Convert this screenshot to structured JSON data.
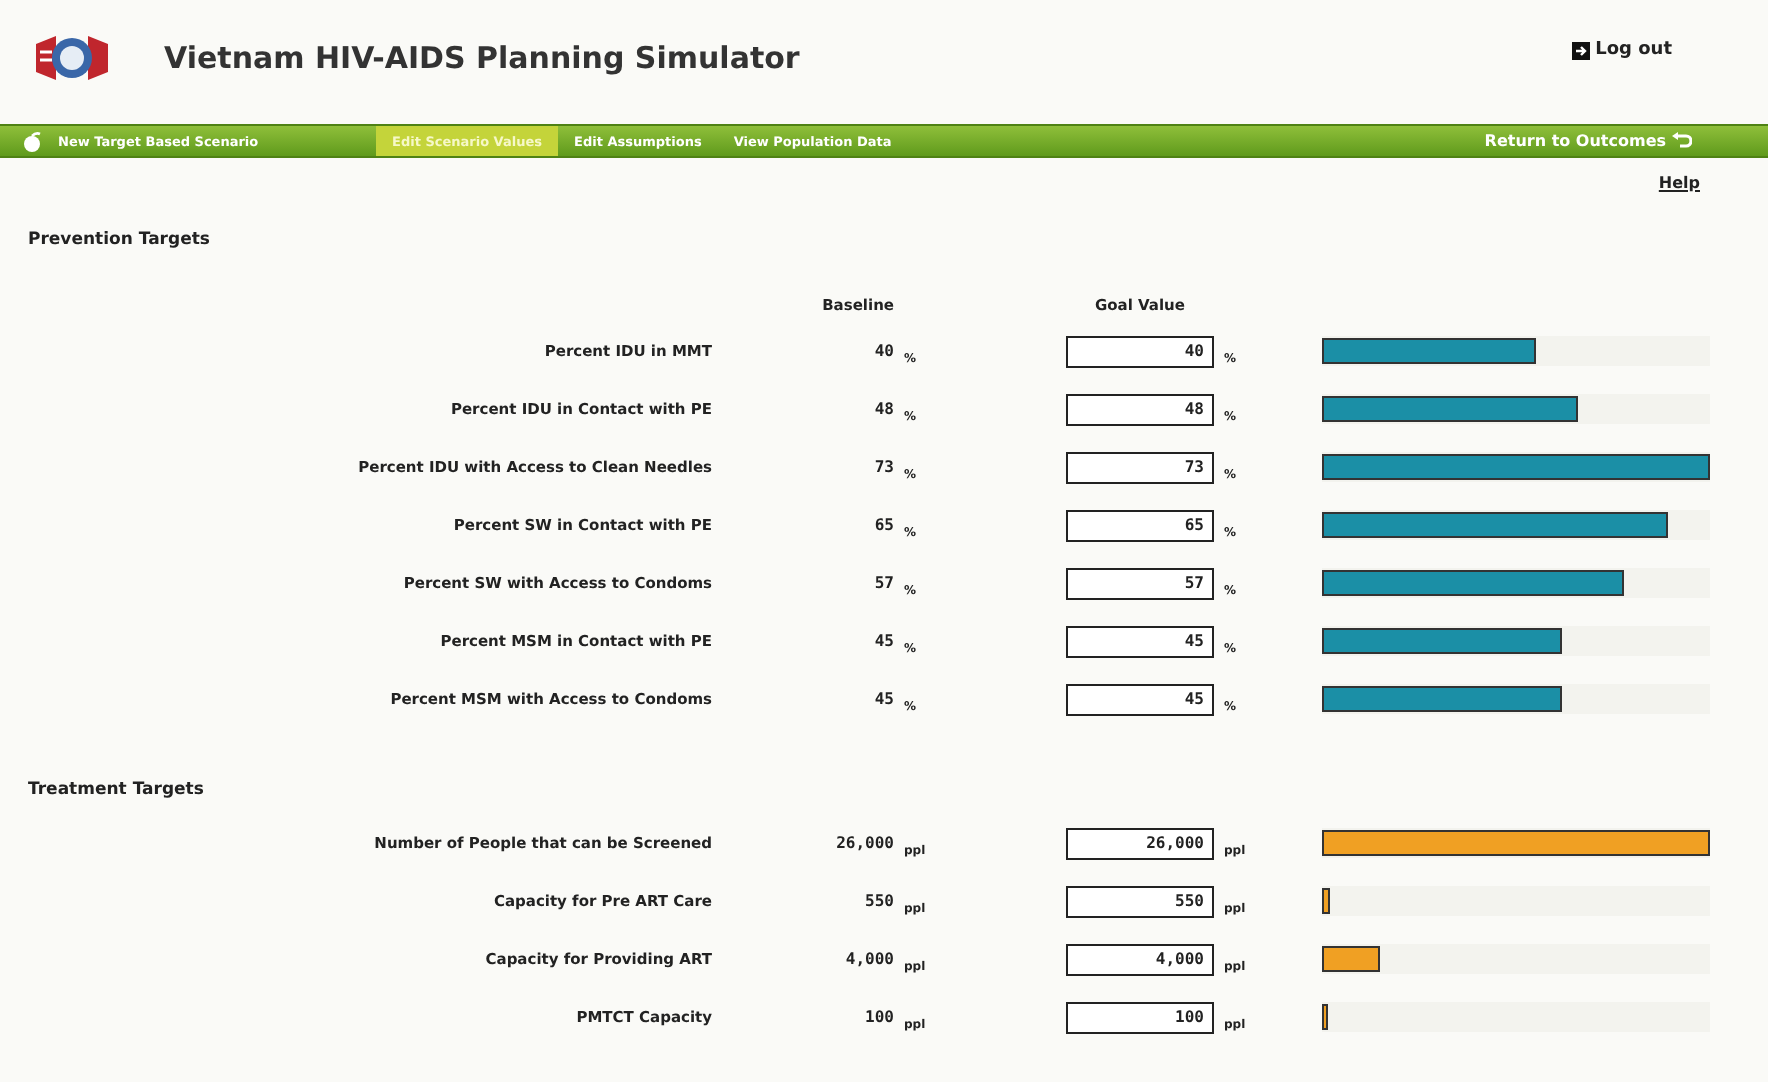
{
  "header": {
    "title": "Vietnam HIV-AIDS Planning Simulator",
    "logout": "Log out"
  },
  "nav": {
    "items": [
      {
        "label": "New Target Based Scenario",
        "selected": false,
        "kind": "new"
      },
      {
        "label": "Edit Scenario Values",
        "selected": true,
        "kind": "tab"
      },
      {
        "label": "Edit Assumptions",
        "selected": false,
        "kind": "tab"
      },
      {
        "label": "View Population Data",
        "selected": false,
        "kind": "tab"
      }
    ],
    "return": "Return to Outcomes"
  },
  "help": "Help",
  "sections": [
    {
      "title": "Prevention Targets",
      "kind": "prevention",
      "columns": {
        "baseline": "Baseline",
        "goal": "Goal Value"
      },
      "rows": [
        {
          "label": "Percent IDU in MMT",
          "baseline": "40",
          "unit": "%",
          "goal": "40",
          "goal_unit": "%",
          "level": 0.55
        },
        {
          "label": "Percent IDU in Contact with PE",
          "baseline": "48",
          "unit": "%",
          "goal": "48",
          "goal_unit": "%",
          "level": 0.66
        },
        {
          "label": "Percent IDU with Access to Clean Needles",
          "baseline": "73",
          "unit": "%",
          "goal": "73",
          "goal_unit": "%",
          "level": 1.0
        },
        {
          "label": "Percent SW in Contact with PE",
          "baseline": "65",
          "unit": "%",
          "goal": "65",
          "goal_unit": "%",
          "level": 0.89
        },
        {
          "label": "Percent SW with Access to Condoms",
          "baseline": "57",
          "unit": "%",
          "goal": "57",
          "goal_unit": "%",
          "level": 0.78
        },
        {
          "label": "Percent MSM in Contact with PE",
          "baseline": "45",
          "unit": "%",
          "goal": "45",
          "goal_unit": "%",
          "level": 0.62
        },
        {
          "label": "Percent MSM with Access to Condoms",
          "baseline": "45",
          "unit": "%",
          "goal": "45",
          "goal_unit": "%",
          "level": 0.62
        }
      ]
    },
    {
      "title": "Treatment Targets",
      "kind": "treatment",
      "rows": [
        {
          "label": "Number of People that can be Screened",
          "baseline": "26,000",
          "unit": "ppl",
          "goal": "26,000",
          "goal_unit": "ppl",
          "level": 1.0
        },
        {
          "label": "Capacity for Pre ART Care",
          "baseline": "550",
          "unit": "ppl",
          "goal": "550",
          "goal_unit": "ppl",
          "level": 0.02
        },
        {
          "label": "Capacity for Providing ART",
          "baseline": "4,000",
          "unit": "ppl",
          "goal": "4,000",
          "goal_unit": "ppl",
          "level": 0.15
        },
        {
          "label": "PMTCT Capacity",
          "baseline": "100",
          "unit": "ppl",
          "goal": "100",
          "goal_unit": "ppl",
          "level": 0.01
        }
      ]
    }
  ]
}
